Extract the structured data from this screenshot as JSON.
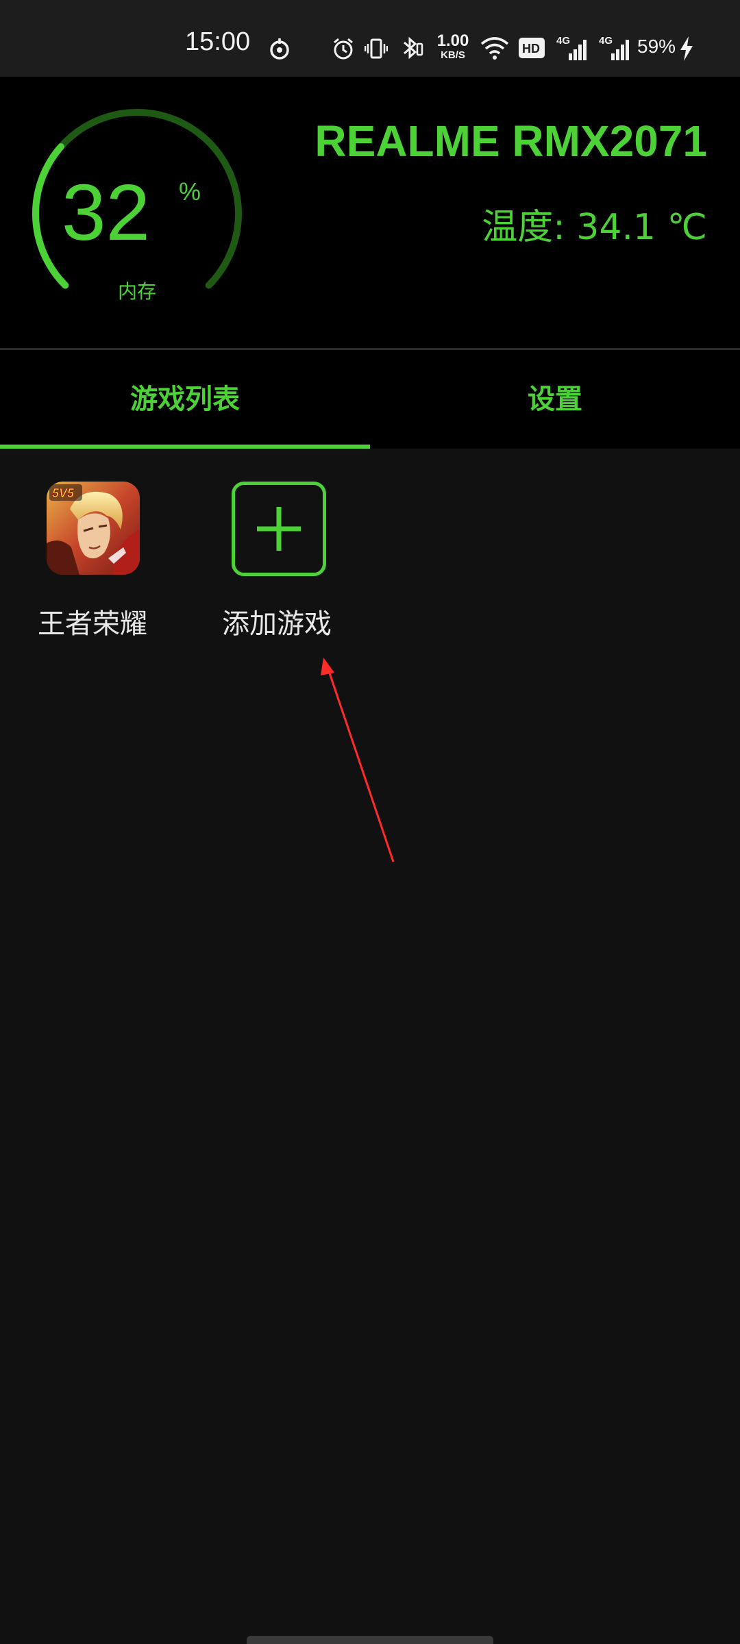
{
  "status_bar": {
    "time": "15:00",
    "net_speed_value": "1.00",
    "net_speed_unit": "KB/S",
    "sim1_label": "4G",
    "sim2_label": "4G",
    "battery": "59%",
    "icons": [
      "game-mode-icon",
      "alarm-icon",
      "vibrate-icon",
      "bluetooth-icon",
      "wifi-icon",
      "hd-icon",
      "signal-icon",
      "signal-icon",
      "charging-icon"
    ]
  },
  "header": {
    "memory_value": "32",
    "memory_percent_sign": "%",
    "memory_fraction": 0.32,
    "memory_label": "内存",
    "device_name": "REALME RMX2071",
    "temperature_label": "温度: 34.1 ℃"
  },
  "tabs": [
    {
      "label": "游戏列表",
      "selected": true
    },
    {
      "label": "设置",
      "selected": false
    }
  ],
  "games": [
    {
      "label": "王者荣耀",
      "icon": "honor-of-kings-icon",
      "badge": "5V5"
    },
    {
      "label": "添加游戏",
      "icon": "plus-icon"
    }
  ],
  "colors": {
    "accent": "#4cd137",
    "header_bg": "#000000",
    "content_bg": "#111111",
    "status_bg": "#1d1d1d",
    "annotation": "#ff2a2a"
  }
}
